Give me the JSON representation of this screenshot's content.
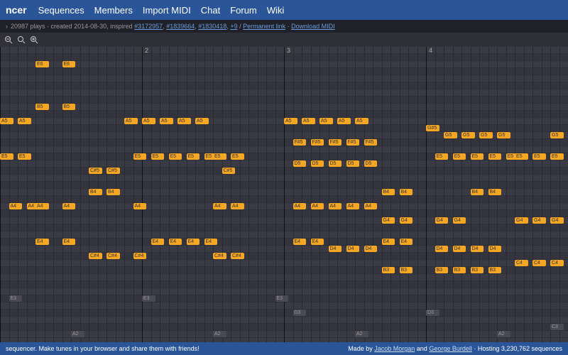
{
  "nav": {
    "logo": "ncer",
    "items": [
      "Sequences",
      "Members",
      "Import MIDI",
      "Chat",
      "Forum",
      "Wiki"
    ]
  },
  "info": {
    "plays": "20987 plays",
    "created": "created 2014-08-30, inspired",
    "inspired_links": [
      "#3172957",
      "#1839664",
      "#1830418"
    ],
    "more": "+9",
    "permalink": "Permanent link",
    "download": "Download MIDI"
  },
  "toolbar": {
    "icons": [
      "magnify-minus-icon",
      "magnify-reset-icon",
      "magnify-plus-icon"
    ]
  },
  "grid": {
    "cols": 64,
    "measure_every": 16,
    "measure_labels": [
      "2",
      "3",
      "4"
    ],
    "rows": 41
  },
  "notes": [
    {
      "r": 2,
      "c": 4,
      "w": 1,
      "l": "E6"
    },
    {
      "r": 2,
      "c": 7,
      "w": 1,
      "l": "E6"
    },
    {
      "r": 8,
      "c": 4,
      "w": 1,
      "l": "B5"
    },
    {
      "r": 8,
      "c": 7,
      "w": 1,
      "l": "B5"
    },
    {
      "r": 10,
      "c": 0,
      "w": 1,
      "l": "A5"
    },
    {
      "r": 10,
      "c": 2,
      "w": 1,
      "l": "A5"
    },
    {
      "r": 10,
      "c": 14,
      "w": 1,
      "l": "A5"
    },
    {
      "r": 10,
      "c": 16,
      "w": 1,
      "l": "A5"
    },
    {
      "r": 10,
      "c": 18,
      "w": 1,
      "l": "A5"
    },
    {
      "r": 10,
      "c": 20,
      "w": 1,
      "l": "A5"
    },
    {
      "r": 10,
      "c": 22,
      "w": 1,
      "l": "A5"
    },
    {
      "r": 10,
      "c": 32,
      "w": 1,
      "l": "A5"
    },
    {
      "r": 10,
      "c": 34,
      "w": 1,
      "l": "A5"
    },
    {
      "r": 10,
      "c": 36,
      "w": 1,
      "l": "A5"
    },
    {
      "r": 10,
      "c": 38,
      "w": 1,
      "l": "A5"
    },
    {
      "r": 10,
      "c": 40,
      "w": 1,
      "l": "A5"
    },
    {
      "r": 11,
      "c": 48,
      "w": 1,
      "l": "G#5"
    },
    {
      "r": 12,
      "c": 50,
      "w": 1,
      "l": "G5"
    },
    {
      "r": 12,
      "c": 52,
      "w": 1,
      "l": "G5"
    },
    {
      "r": 12,
      "c": 54,
      "w": 1,
      "l": "G5"
    },
    {
      "r": 12,
      "c": 56,
      "w": 1,
      "l": "G5"
    },
    {
      "r": 12,
      "c": 62,
      "w": 1,
      "l": "G5"
    },
    {
      "r": 13,
      "c": 33,
      "w": 1,
      "l": "F#5"
    },
    {
      "r": 13,
      "c": 35,
      "w": 1,
      "l": "F#5"
    },
    {
      "r": 13,
      "c": 37,
      "w": 1,
      "l": "F#5"
    },
    {
      "r": 13,
      "c": 39,
      "w": 1,
      "l": "F#5"
    },
    {
      "r": 13,
      "c": 41,
      "w": 1,
      "l": "F#5"
    },
    {
      "r": 15,
      "c": 0,
      "w": 1,
      "l": "E5"
    },
    {
      "r": 15,
      "c": 2,
      "w": 1,
      "l": "E5"
    },
    {
      "r": 15,
      "c": 15,
      "w": 1,
      "l": "E5"
    },
    {
      "r": 15,
      "c": 17,
      "w": 1,
      "l": "E5"
    },
    {
      "r": 15,
      "c": 19,
      "w": 1,
      "l": "E5"
    },
    {
      "r": 15,
      "c": 21,
      "w": 1,
      "l": "E5"
    },
    {
      "r": 15,
      "c": 23,
      "w": 1,
      "l": "E5"
    },
    {
      "r": 15,
      "c": 24,
      "w": 1,
      "l": "E5"
    },
    {
      "r": 15,
      "c": 26,
      "w": 1,
      "l": "E5"
    },
    {
      "r": 15,
      "c": 49,
      "w": 1,
      "l": "E5"
    },
    {
      "r": 15,
      "c": 51,
      "w": 1,
      "l": "E5"
    },
    {
      "r": 15,
      "c": 53,
      "w": 1,
      "l": "E5"
    },
    {
      "r": 15,
      "c": 55,
      "w": 1,
      "l": "E5"
    },
    {
      "r": 15,
      "c": 57,
      "w": 1,
      "l": "E5"
    },
    {
      "r": 15,
      "c": 58,
      "w": 1,
      "l": "E5"
    },
    {
      "r": 15,
      "c": 60,
      "w": 1,
      "l": "E5"
    },
    {
      "r": 15,
      "c": 62,
      "w": 1,
      "l": "E5"
    },
    {
      "r": 16,
      "c": 33,
      "w": 1,
      "l": "D5"
    },
    {
      "r": 16,
      "c": 35,
      "w": 1,
      "l": "D5"
    },
    {
      "r": 16,
      "c": 37,
      "w": 1,
      "l": "D5"
    },
    {
      "r": 16,
      "c": 39,
      "w": 1,
      "l": "D5"
    },
    {
      "r": 16,
      "c": 41,
      "w": 1,
      "l": "D5"
    },
    {
      "r": 17,
      "c": 10,
      "w": 1,
      "l": "C#5"
    },
    {
      "r": 17,
      "c": 12,
      "w": 1,
      "l": "C#5"
    },
    {
      "r": 17,
      "c": 25,
      "w": 1,
      "l": "C#5"
    },
    {
      "r": 20,
      "c": 10,
      "w": 1,
      "l": "B4"
    },
    {
      "r": 20,
      "c": 12,
      "w": 1,
      "l": "B4"
    },
    {
      "r": 20,
      "c": 43,
      "w": 1,
      "l": "B4"
    },
    {
      "r": 20,
      "c": 45,
      "w": 1,
      "l": "B4"
    },
    {
      "r": 20,
      "c": 53,
      "w": 1,
      "l": "B4"
    },
    {
      "r": 20,
      "c": 55,
      "w": 1,
      "l": "B4"
    },
    {
      "r": 22,
      "c": 1,
      "w": 1,
      "l": "A4"
    },
    {
      "r": 22,
      "c": 3,
      "w": 1,
      "l": "A4"
    },
    {
      "r": 22,
      "c": 4,
      "w": 1,
      "l": "A4"
    },
    {
      "r": 22,
      "c": 7,
      "w": 1,
      "l": "A4"
    },
    {
      "r": 22,
      "c": 15,
      "w": 1,
      "l": "A4"
    },
    {
      "r": 22,
      "c": 24,
      "w": 1,
      "l": "A4"
    },
    {
      "r": 22,
      "c": 26,
      "w": 1,
      "l": "A4"
    },
    {
      "r": 22,
      "c": 33,
      "w": 1,
      "l": "A4"
    },
    {
      "r": 22,
      "c": 35,
      "w": 1,
      "l": "A4"
    },
    {
      "r": 22,
      "c": 37,
      "w": 1,
      "l": "A4"
    },
    {
      "r": 22,
      "c": 39,
      "w": 1,
      "l": "A4"
    },
    {
      "r": 22,
      "c": 41,
      "w": 1,
      "l": "A4"
    },
    {
      "r": 24,
      "c": 43,
      "w": 1,
      "l": "G4"
    },
    {
      "r": 24,
      "c": 45,
      "w": 1,
      "l": "G4"
    },
    {
      "r": 24,
      "c": 49,
      "w": 1,
      "l": "G4"
    },
    {
      "r": 24,
      "c": 51,
      "w": 1,
      "l": "G4"
    },
    {
      "r": 24,
      "c": 58,
      "w": 1,
      "l": "G4"
    },
    {
      "r": 24,
      "c": 60,
      "w": 1,
      "l": "G4"
    },
    {
      "r": 24,
      "c": 62,
      "w": 1,
      "l": "G4"
    },
    {
      "r": 27,
      "c": 4,
      "w": 1,
      "l": "E4"
    },
    {
      "r": 27,
      "c": 7,
      "w": 1,
      "l": "E4"
    },
    {
      "r": 27,
      "c": 17,
      "w": 1,
      "l": "E4"
    },
    {
      "r": 27,
      "c": 19,
      "w": 1,
      "l": "E4"
    },
    {
      "r": 27,
      "c": 21,
      "w": 1,
      "l": "E4"
    },
    {
      "r": 27,
      "c": 23,
      "w": 1,
      "l": "E4"
    },
    {
      "r": 27,
      "c": 33,
      "w": 1,
      "l": "E4"
    },
    {
      "r": 27,
      "c": 35,
      "w": 1,
      "l": "E4"
    },
    {
      "r": 27,
      "c": 43,
      "w": 1,
      "l": "E4"
    },
    {
      "r": 27,
      "c": 45,
      "w": 1,
      "l": "E4"
    },
    {
      "r": 28,
      "c": 37,
      "w": 1,
      "l": "D4"
    },
    {
      "r": 28,
      "c": 39,
      "w": 1,
      "l": "D4"
    },
    {
      "r": 28,
      "c": 41,
      "w": 1,
      "l": "D4"
    },
    {
      "r": 28,
      "c": 49,
      "w": 1,
      "l": "D4"
    },
    {
      "r": 28,
      "c": 51,
      "w": 1,
      "l": "D4"
    },
    {
      "r": 28,
      "c": 53,
      "w": 1,
      "l": "D4"
    },
    {
      "r": 28,
      "c": 55,
      "w": 1,
      "l": "D4"
    },
    {
      "r": 29,
      "c": 10,
      "w": 1,
      "l": "C#4"
    },
    {
      "r": 29,
      "c": 12,
      "w": 1,
      "l": "C#4"
    },
    {
      "r": 29,
      "c": 15,
      "w": 1,
      "l": "C#4"
    },
    {
      "r": 29,
      "c": 24,
      "w": 1,
      "l": "C#4"
    },
    {
      "r": 29,
      "c": 26,
      "w": 1,
      "l": "C#4"
    },
    {
      "r": 30,
      "c": 58,
      "w": 1,
      "l": "C4"
    },
    {
      "r": 30,
      "c": 60,
      "w": 1,
      "l": "C4"
    },
    {
      "r": 30,
      "c": 62,
      "w": 1,
      "l": "C4"
    },
    {
      "r": 31,
      "c": 43,
      "w": 1,
      "l": "B3"
    },
    {
      "r": 31,
      "c": 45,
      "w": 1,
      "l": "B3"
    },
    {
      "r": 31,
      "c": 49,
      "w": 1,
      "l": "B3"
    },
    {
      "r": 31,
      "c": 51,
      "w": 1,
      "l": "B3"
    },
    {
      "r": 31,
      "c": 53,
      "w": 1,
      "l": "B3"
    },
    {
      "r": 31,
      "c": 55,
      "w": 1,
      "l": "B3"
    },
    {
      "r": 35,
      "c": 1,
      "w": 1,
      "l": "E3",
      "d": true
    },
    {
      "r": 35,
      "c": 16,
      "w": 1,
      "l": "E3",
      "d": true
    },
    {
      "r": 35,
      "c": 31,
      "w": 1,
      "l": "E3",
      "d": true
    },
    {
      "r": 37,
      "c": 33,
      "w": 1,
      "l": "D3",
      "d": true
    },
    {
      "r": 37,
      "c": 48,
      "w": 1,
      "l": "D3",
      "d": true
    },
    {
      "r": 39,
      "c": 62,
      "w": 1,
      "l": "C3",
      "d": true
    },
    {
      "r": 40,
      "c": 8,
      "w": 1,
      "l": "A2",
      "d": true
    },
    {
      "r": 40,
      "c": 24,
      "w": 1,
      "l": "A2",
      "d": true
    },
    {
      "r": 40,
      "c": 40,
      "w": 1,
      "l": "A2",
      "d": true
    },
    {
      "r": 40,
      "c": 56,
      "w": 1,
      "l": "A2",
      "d": true
    }
  ],
  "footer": {
    "left": "sequencer. Make tunes in your browser and share them with friends!",
    "made_by": "Made by",
    "author1": "Jacob Morgan",
    "and": "and",
    "author2": "George Burdell",
    "hosting": "· Hosting 3,230,762 sequences"
  }
}
